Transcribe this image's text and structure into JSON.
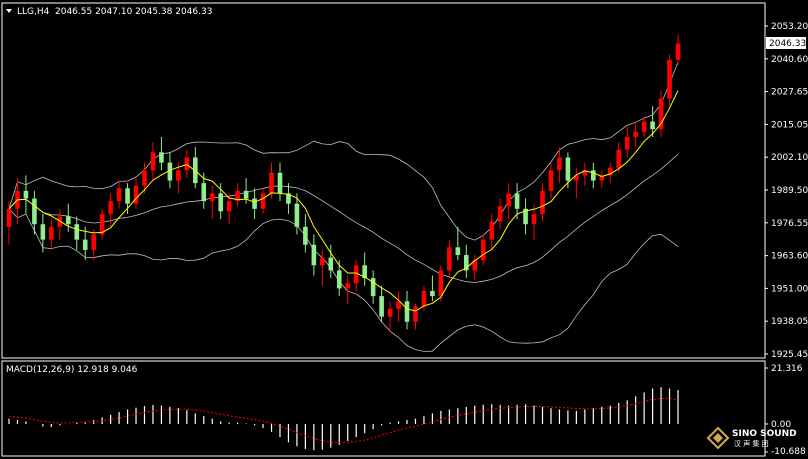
{
  "header": {
    "symbol": "LLG,H4",
    "ohlc": "2046.55 2047.10 2045.38 2046.33"
  },
  "price_panel": {
    "current_price": "2046.33",
    "axis_labels": [
      "2053.20",
      "2040.60",
      "2027.65",
      "2015.05",
      "2002.10",
      "1989.50",
      "1976.55",
      "1963.60",
      "1951.00",
      "1938.05",
      "1925.45"
    ]
  },
  "macd_panel": {
    "label": "MACD(12,26,9) 12.918 9.046",
    "axis_labels": [
      "21.316",
      "0.00",
      "-10.688"
    ]
  },
  "watermark": {
    "brand": "SINO SOUND",
    "sub": "汉 声 集 团"
  },
  "colors": {
    "background": "#000000",
    "bull_candle": "#ff0000",
    "bear_candle": "#90ee90",
    "fast_ma": "#ffff00",
    "bollinger": "#c0c0c0",
    "signal": "#ff0000",
    "histogram": "#ffffff"
  },
  "chart_data": {
    "type": "candlestick",
    "price_range": [
      1925.45,
      2053.2
    ],
    "macd_range": [
      -10.688,
      21.316
    ],
    "candles": [
      [
        1975,
        1985,
        1968,
        1982
      ],
      [
        1982,
        1994,
        1976,
        1989
      ],
      [
        1989,
        1995,
        1980,
        1986
      ],
      [
        1986,
        1989,
        1972,
        1976
      ],
      [
        1976,
        1980,
        1965,
        1970
      ],
      [
        1970,
        1978,
        1966,
        1975
      ],
      [
        1975,
        1982,
        1970,
        1979
      ],
      [
        1979,
        1984,
        1973,
        1976
      ],
      [
        1976,
        1979,
        1966,
        1970
      ],
      [
        1970,
        1975,
        1962,
        1966
      ],
      [
        1966,
        1974,
        1962,
        1972
      ],
      [
        1972,
        1982,
        1970,
        1980
      ],
      [
        1980,
        1988,
        1975,
        1985
      ],
      [
        1985,
        1993,
        1982,
        1990
      ],
      [
        1990,
        1992,
        1980,
        1984
      ],
      [
        1984,
        1994,
        1982,
        1991
      ],
      [
        1991,
        2000,
        1988,
        1997
      ],
      [
        1997,
        2008,
        1993,
        2004
      ],
      [
        2004,
        2010,
        1997,
        2000
      ],
      [
        2000,
        2004,
        1990,
        1993
      ],
      [
        1993,
        2000,
        1988,
        1997
      ],
      [
        1997,
        2005,
        1994,
        2002
      ],
      [
        2002,
        2006,
        1990,
        1992
      ],
      [
        1992,
        1996,
        1982,
        1985
      ],
      [
        1985,
        1991,
        1978,
        1988
      ],
      [
        1988,
        1992,
        1978,
        1981
      ],
      [
        1981,
        1988,
        1976,
        1985
      ],
      [
        1985,
        1992,
        1983,
        1989
      ],
      [
        1989,
        1994,
        1984,
        1986
      ],
      [
        1986,
        1990,
        1978,
        1982
      ],
      [
        1982,
        1990,
        1980,
        1988
      ],
      [
        1988,
        2000,
        1986,
        1996
      ],
      [
        1996,
        2000,
        1985,
        1988
      ],
      [
        1988,
        1992,
        1980,
        1984
      ],
      [
        1984,
        1988,
        1972,
        1975
      ],
      [
        1975,
        1980,
        1965,
        1968
      ],
      [
        1968,
        1972,
        1956,
        1960
      ],
      [
        1960,
        1966,
        1952,
        1963
      ],
      [
        1963,
        1968,
        1955,
        1958
      ],
      [
        1958,
        1962,
        1948,
        1951
      ],
      [
        1951,
        1956,
        1945,
        1953
      ],
      [
        1953,
        1962,
        1950,
        1960
      ],
      [
        1960,
        1965,
        1952,
        1955
      ],
      [
        1955,
        1958,
        1945,
        1948
      ],
      [
        1948,
        1952,
        1938,
        1940
      ],
      [
        1940,
        1946,
        1934,
        1943
      ],
      [
        1943,
        1950,
        1938,
        1946
      ],
      [
        1946,
        1950,
        1935,
        1938
      ],
      [
        1938,
        1945,
        1935,
        1944
      ],
      [
        1944,
        1952,
        1942,
        1950
      ],
      [
        1950,
        1956,
        1946,
        1948
      ],
      [
        1948,
        1960,
        1946,
        1958
      ],
      [
        1958,
        1970,
        1955,
        1967
      ],
      [
        1967,
        1975,
        1962,
        1964
      ],
      [
        1964,
        1968,
        1955,
        1958
      ],
      [
        1958,
        1964,
        1954,
        1962
      ],
      [
        1962,
        1972,
        1960,
        1970
      ],
      [
        1970,
        1980,
        1966,
        1977
      ],
      [
        1977,
        1986,
        1974,
        1983
      ],
      [
        1983,
        1992,
        1978,
        1988
      ],
      [
        1988,
        1992,
        1978,
        1982
      ],
      [
        1982,
        1986,
        1972,
        1976
      ],
      [
        1976,
        1984,
        1970,
        1980
      ],
      [
        1980,
        1992,
        1977,
        1989
      ],
      [
        1989,
        2000,
        1986,
        1997
      ],
      [
        1997,
        2006,
        1992,
        2002
      ],
      [
        2002,
        2004,
        1990,
        1993
      ],
      [
        1993,
        1998,
        1986,
        1995
      ],
      [
        1995,
        2000,
        1991,
        1997
      ],
      [
        1997,
        2000,
        1990,
        1993
      ],
      [
        1993,
        1997,
        1990,
        1995
      ],
      [
        1995,
        2000,
        1992,
        1998
      ],
      [
        1998,
        2008,
        1996,
        2005
      ],
      [
        2005,
        2014,
        2002,
        2010
      ],
      [
        2010,
        2016,
        2006,
        2012
      ],
      [
        2012,
        2018,
        2010,
        2016
      ],
      [
        2016,
        2022,
        2010,
        2013
      ],
      [
        2013,
        2028,
        2010,
        2025
      ],
      [
        2025,
        2042,
        2022,
        2040
      ],
      [
        2040,
        2050,
        2038,
        2046.33
      ]
    ],
    "macd": [
      2,
      1.5,
      1.0,
      0,
      -1,
      -1.2,
      -0.5,
      0,
      0.5,
      0.8,
      1.5,
      2.5,
      3.5,
      4.5,
      5.5,
      6.2,
      6.8,
      7.2,
      7.0,
      6.5,
      6.0,
      5.2,
      4.0,
      3.0,
      2.0,
      1.0,
      0.5,
      0.5,
      0.2,
      -0.5,
      -1.5,
      -3,
      -5,
      -7,
      -8.5,
      -9.5,
      -10,
      -9.8,
      -9,
      -8,
      -6.5,
      -5,
      -3.5,
      -2,
      -0.5,
      0.5,
      1,
      1.5,
      2,
      3,
      4,
      5,
      5.5,
      6,
      6.5,
      7,
      7.3,
      7.5,
      7.2,
      7.0,
      7.3,
      7.5,
      7.0,
      6.5,
      6.0,
      5.5,
      5.2,
      5.0,
      5.5,
      6,
      6.5,
      7,
      8,
      9,
      10.5,
      12,
      13.5,
      14,
      13.5,
      12.918
    ],
    "signal": [
      3,
      2.6,
      2.2,
      1.6,
      1.0,
      0.6,
      0.4,
      0.4,
      0.5,
      0.6,
      0.8,
      1.2,
      1.7,
      2.3,
      3.0,
      3.7,
      4.3,
      4.9,
      5.3,
      5.6,
      5.7,
      5.6,
      5.3,
      4.9,
      4.3,
      3.7,
      3.1,
      2.6,
      2.1,
      1.6,
      1.0,
      0.2,
      -0.8,
      -2.0,
      -3.3,
      -4.5,
      -5.6,
      -6.4,
      -7.0,
      -7.2,
      -7.1,
      -6.7,
      -6.1,
      -5.3,
      -4.3,
      -3.3,
      -2.4,
      -1.6,
      -0.9,
      -0.1,
      0.8,
      1.7,
      2.5,
      3.2,
      3.9,
      4.5,
      5.1,
      5.6,
      6.0,
      6.2,
      6.4,
      6.6,
      6.7,
      6.6,
      6.5,
      6.3,
      6.1,
      5.9,
      5.8,
      5.8,
      5.9,
      6.1,
      6.5,
      7.0,
      7.7,
      8.5,
      9.3,
      9.7,
      9.9,
      9.046
    ]
  }
}
